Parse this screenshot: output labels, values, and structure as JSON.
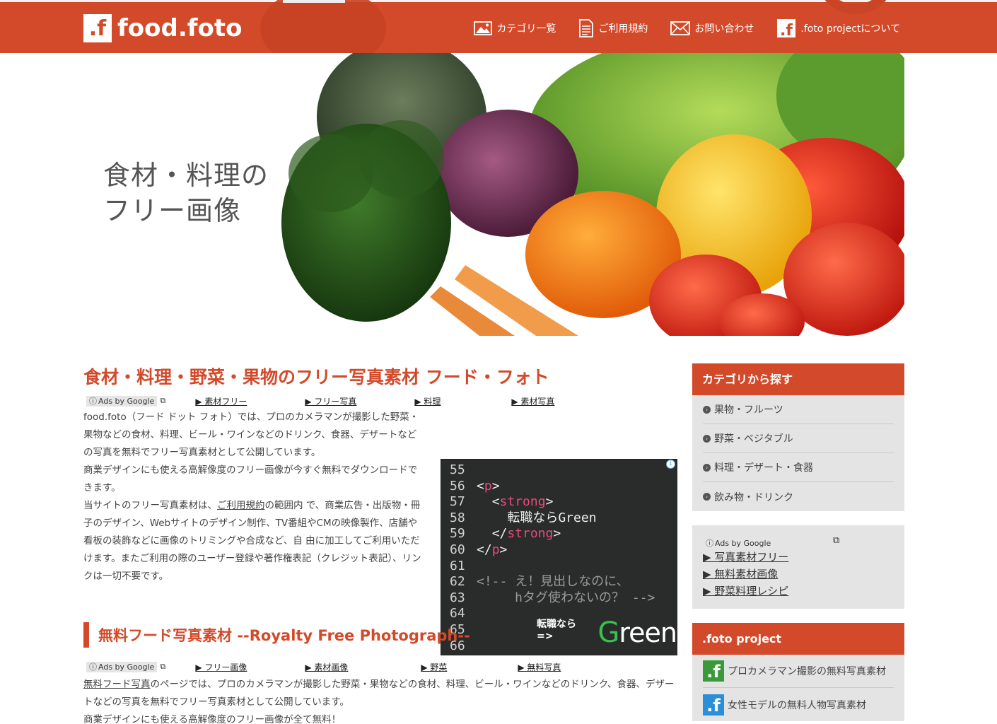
{
  "header": {
    "logo_mark": ".f",
    "logo_text": "food.foto",
    "nav": [
      {
        "label": "カテゴリ一覧",
        "icon": "image-icon"
      },
      {
        "label": "ご利用規約",
        "icon": "document-icon"
      },
      {
        "label": "お問い合わせ",
        "icon": "mail-icon"
      },
      {
        "label": ".foto projectについて",
        "icon": "foto-logo-icon"
      }
    ]
  },
  "hero": {
    "line1": "食材・料理の",
    "line2": "フリー画像"
  },
  "main": {
    "title": "食材・料理・野菜・果物のフリー写真素材 フード・フォト",
    "ads1": {
      "badge": "Ads by Google",
      "links": [
        "▶ 素材フリー",
        "▶ フリー写真",
        "▶ 料理",
        "▶ 素材写真"
      ]
    },
    "intro": {
      "p1": "food.foto（フード ドット フォト）では、プロのカメラマンが撮影した野菜・果物などの食材、料理、ビール・ワインなどのドリンク、食器、デザートなどの写真を無料でフリー写真素材として公開しています。",
      "p2": "商業デザインにも使える高解像度のフリー画像が今すぐ無料でダウンロードできます。",
      "p3a": "当サイトのフリー写真素材は、",
      "p3link": "ご利用規約",
      "p3b": "の範囲内 で、商業広告・出版物・冊子のデザイン、Webサイトのデザイン制作、TV番組やCMの映像製作、店舗や看板の装飾などに画像のトリミングや合成など、自 由に加工してご利用いただけます。またご利用の際のユーザー登録や著作権表記（クレジット表記）、リンクは一切不要です。"
    },
    "code_ad": {
      "lines": [
        {
          "n": "55",
          "html": ""
        },
        {
          "n": "56",
          "html": "<span class='br'>&lt;</span><span class='tag'>p</span><span class='br'>&gt;</span>"
        },
        {
          "n": "57",
          "html": "  <span class='br'>&lt;</span><span class='tag'>strong</span><span class='br'>&gt;</span>"
        },
        {
          "n": "58",
          "html": "    転職ならGreen"
        },
        {
          "n": "59",
          "html": "  <span class='br'>&lt;/</span><span class='tag'>strong</span><span class='br'>&gt;</span>"
        },
        {
          "n": "60",
          "html": "<span class='br'>&lt;/</span><span class='tag'>p</span><span class='br'>&gt;</span>"
        },
        {
          "n": "61",
          "html": ""
        },
        {
          "n": "62",
          "html": "<span class='cmt'>&lt;!-- え！見出しなのに、</span>"
        },
        {
          "n": "63",
          "html": "<span class='cmt'>     hタグ使わないの？ --&gt;</span>"
        },
        {
          "n": "64",
          "html": ""
        },
        {
          "n": "65",
          "html": ""
        },
        {
          "n": "66",
          "html": ""
        }
      ],
      "cta_pre": "転職なら =>",
      "brand_g": "G",
      "brand_rest": "reen"
    },
    "section2": {
      "title": "無料フード写真素材 --Royalty Free Photograph--",
      "ads": {
        "badge": "Ads by Google",
        "links": [
          "▶ フリー画像",
          "▶ 素材画像",
          "▶ 野菜",
          "▶ 無料写真"
        ]
      },
      "p1link": "無料フード写真",
      "p1": "のページでは、プロのカメラマンが撮影した野菜・果物などの食材、料理、ビール・ワインなどのドリンク、食器、デザートなどの写真を無料でフリー写真素材として公開しています。",
      "p2": "商業デザインにも使える高解像度のフリー画像が全て無料！"
    }
  },
  "sidebar": {
    "category_title": "カテゴリから探す",
    "categories": [
      "果物・フルーツ",
      "野菜・ベジタブル",
      "料理・デザート・食器",
      "飲み物・ドリンク"
    ],
    "ads_badge": "Ads by Google",
    "ads_links": [
      "▶ 写真素材フリー",
      "▶ 無料素材画像",
      "▶ 野菜料理レシピ"
    ],
    "project_title": ".foto project",
    "projects": [
      {
        "label": "プロカメラマン撮影の無料写真素材",
        "color": "#3a9a3a"
      },
      {
        "label": "女性モデルの無料人物写真素材",
        "color": "#2a8fd8"
      }
    ]
  },
  "colors": {
    "brand": "#d34a2a",
    "sidebar_bg": "#e4e4e4",
    "ad_bg": "#2a2c2b",
    "green_brand": "#38c24a"
  }
}
